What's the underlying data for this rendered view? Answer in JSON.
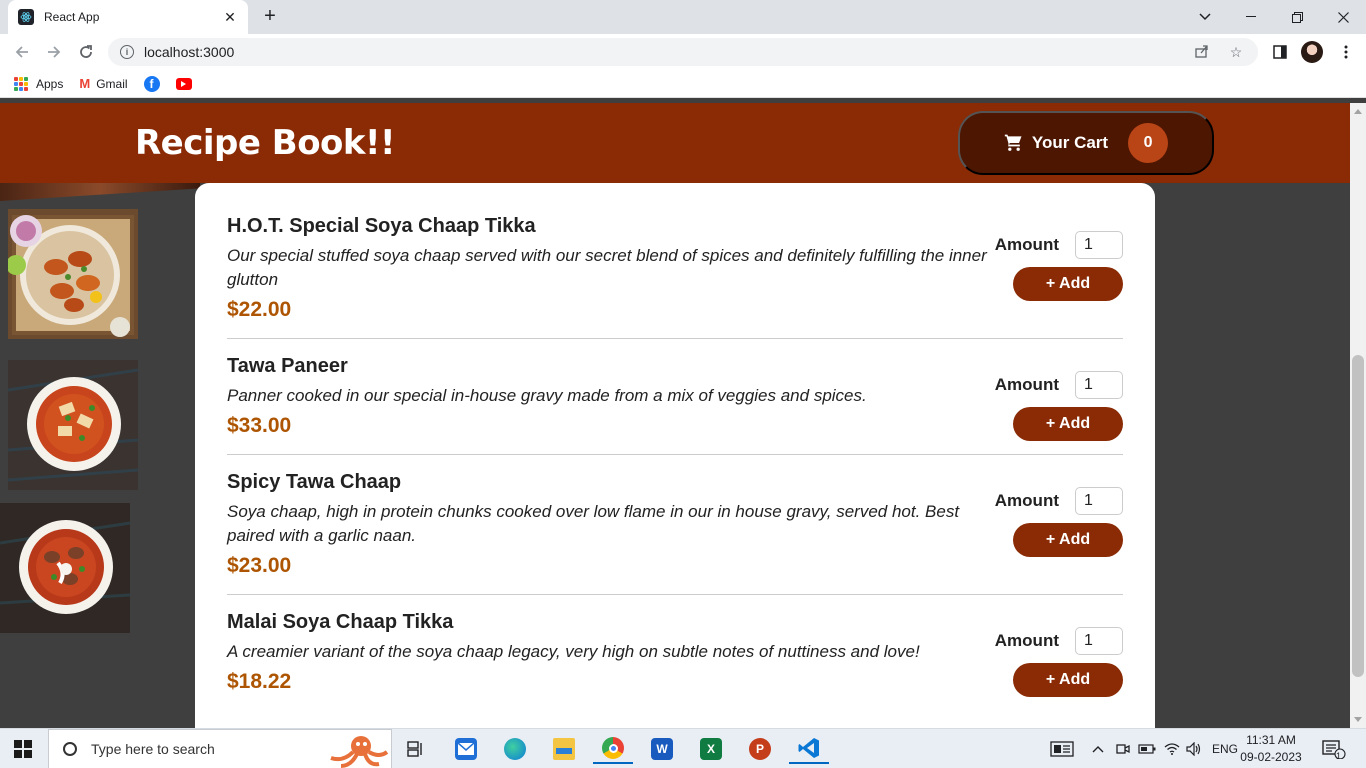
{
  "browser": {
    "tab_title": "React App",
    "url": "localhost:3000",
    "bookmarks": [
      {
        "label": "Apps",
        "icon": "apps-grid-icon"
      },
      {
        "label": "Gmail",
        "icon": "gmail-icon"
      },
      {
        "label": "",
        "icon": "facebook-icon"
      },
      {
        "label": "",
        "icon": "youtube-icon"
      }
    ]
  },
  "header": {
    "title": "Recipe Book!!",
    "cart_label": "Your Cart",
    "cart_count": "0"
  },
  "meals": [
    {
      "name": "H.O.T. Special Soya Chaap Tikka",
      "description": "Our special stuffed soya chaap served with our secret blend of spices and definitely fulfilling the inner glutton",
      "price": "$22.00",
      "amount_label": "Amount",
      "amount": "1",
      "add_label": "+ Add"
    },
    {
      "name": "Tawa Paneer",
      "description": "Panner cooked in our special in-house gravy made from a mix of veggies and spices.",
      "price": "$33.00",
      "amount_label": "Amount",
      "amount": "1",
      "add_label": "+ Add"
    },
    {
      "name": "Spicy Tawa Chaap",
      "description": "Soya chaap, high in protein chunks cooked over low flame in our in house gravy, served hot. Best paired with a garlic naan.",
      "price": "$23.00",
      "amount_label": "Amount",
      "amount": "1",
      "add_label": "+ Add"
    },
    {
      "name": "Malai Soya Chaap Tikka",
      "description": "A creamier variant of the soya chaap legacy, very high on subtle notes of nuttiness and love!",
      "price": "$18.22",
      "amount_label": "Amount",
      "amount": "1",
      "add_label": "+ Add"
    }
  ],
  "taskbar": {
    "search_placeholder": "Type here to search",
    "language": "ENG",
    "time": "11:31 AM",
    "date": "09-02-2023",
    "notification_count": "1"
  },
  "colors": {
    "header_bg": "#8a2b06",
    "cart_bg": "#4d1601",
    "badge_bg": "#b94517",
    "price": "#ad5502",
    "page_bg": "#3f3f3f"
  }
}
